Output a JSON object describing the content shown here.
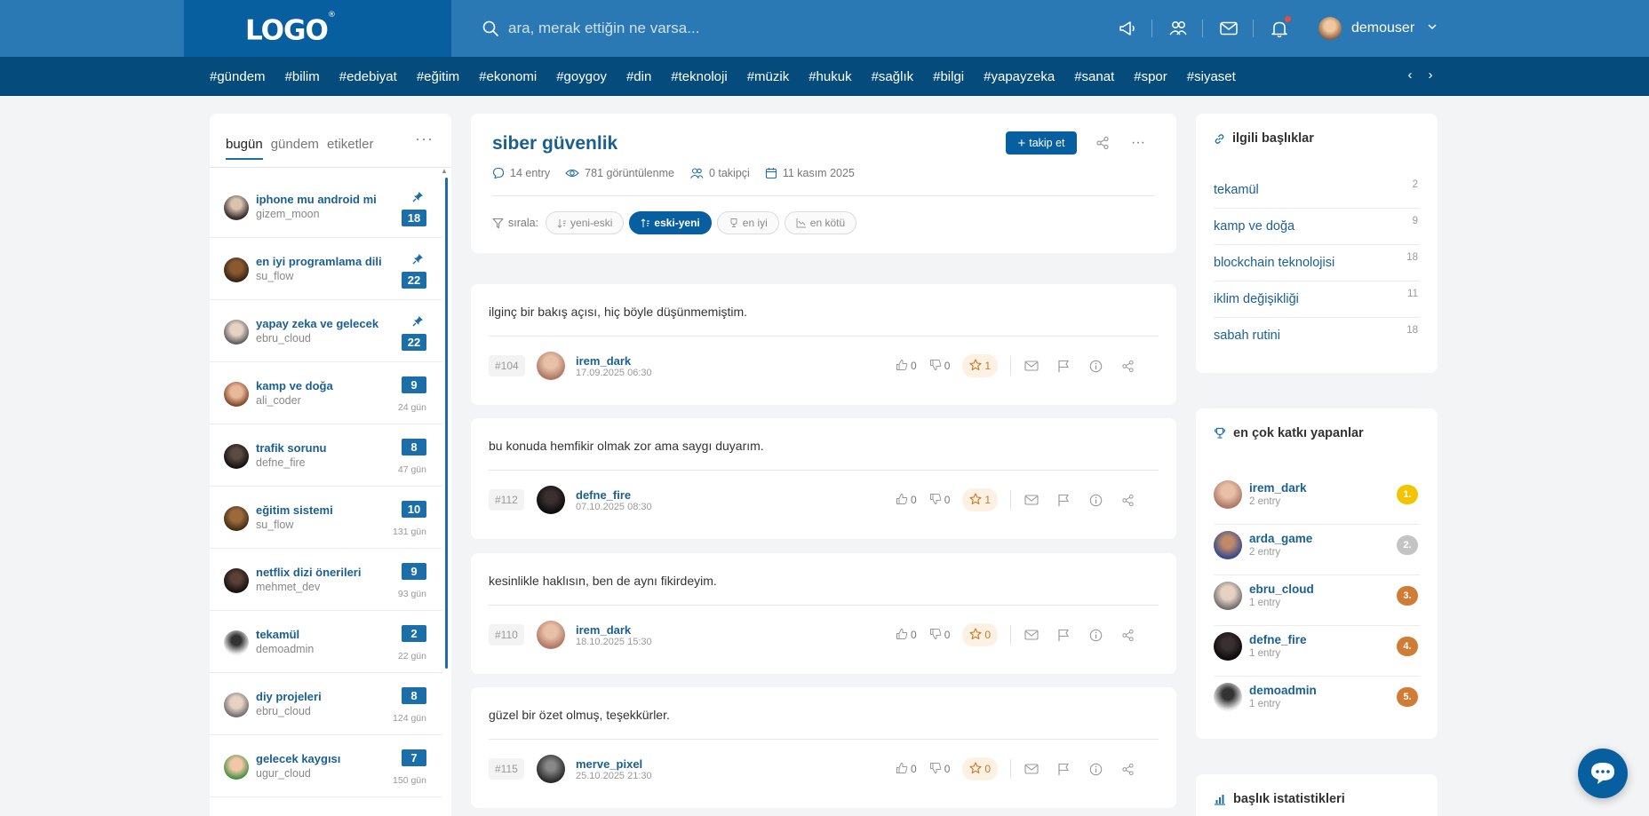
{
  "header": {
    "logo": "LOGO",
    "logo_mark": "®",
    "search_placeholder": "ara, merak ettiğin ne varsa...",
    "username": "demouser"
  },
  "tags": [
    "#gündem",
    "#bilim",
    "#edebiyat",
    "#eğitim",
    "#ekonomi",
    "#goygoy",
    "#din",
    "#teknoloji",
    "#müzik",
    "#hukuk",
    "#sağlık",
    "#bilgi",
    "#yapayzeka",
    "#sanat",
    "#spor",
    "#siyaset"
  ],
  "sidebar": {
    "tabs": [
      "bugün",
      "gündem",
      "etiketler"
    ],
    "more": "···",
    "topics": [
      {
        "title": "iphone mu android mi",
        "user": "gizem_moon",
        "count": "18",
        "pinned": true,
        "age": ""
      },
      {
        "title": "en iyi programlama dili",
        "user": "su_flow",
        "count": "22",
        "pinned": true,
        "age": ""
      },
      {
        "title": "yapay zeka ve gelecek",
        "user": "ebru_cloud",
        "count": "22",
        "pinned": true,
        "age": ""
      },
      {
        "title": "kamp ve doğa",
        "user": "ali_coder",
        "count": "9",
        "pinned": false,
        "age": "24 gün"
      },
      {
        "title": "trafik sorunu",
        "user": "defne_fire",
        "count": "8",
        "pinned": false,
        "age": "47 gün"
      },
      {
        "title": "eğitim sistemi",
        "user": "su_flow",
        "count": "10",
        "pinned": false,
        "age": "131 gün"
      },
      {
        "title": "netflix dizi önerileri",
        "user": "mehmet_dev",
        "count": "9",
        "pinned": false,
        "age": "93 gün"
      },
      {
        "title": "tekamül",
        "user": "demoadmin",
        "count": "2",
        "pinned": false,
        "age": "22 gün"
      },
      {
        "title": "diy projeleri",
        "user": "ebru_cloud",
        "count": "8",
        "pinned": false,
        "age": "124 gün"
      },
      {
        "title": "gelecek kaygısı",
        "user": "ugur_cloud",
        "count": "7",
        "pinned": false,
        "age": "150 gün"
      }
    ]
  },
  "topic": {
    "title": "siber güvenlik",
    "follow_label": "takip et",
    "entries_count": "14 entry",
    "views": "781 görüntülenme",
    "followers": "0 takipçi",
    "date": "11 kasım 2025",
    "sort_label": "sırala:",
    "sort_options": [
      "yeni-eski",
      "eski-yeni",
      "en iyi",
      "en kötü"
    ],
    "sort_active": 1
  },
  "entries": [
    {
      "text": "ilginç bir bakış açısı, hiç böyle düşünmemiştim.",
      "num": "#104",
      "user": "irem_dark",
      "date": "17.09.2025 06:30",
      "up": "0",
      "down": "0",
      "fav": "1"
    },
    {
      "text": "bu konuda hemfikir olmak zor ama saygı duyarım.",
      "num": "#112",
      "user": "defne_fire",
      "date": "07.10.2025 08:30",
      "up": "0",
      "down": "0",
      "fav": "1"
    },
    {
      "text": "kesinlikle haklısın, ben de aynı fikirdeyim.",
      "num": "#110",
      "user": "irem_dark",
      "date": "18.10.2025 15:30",
      "up": "0",
      "down": "0",
      "fav": "0"
    },
    {
      "text": "güzel bir özet olmuş, teşekkürler.",
      "num": "#115",
      "user": "merve_pixel",
      "date": "25.10.2025 21:30",
      "up": "0",
      "down": "0",
      "fav": "0"
    }
  ],
  "related": {
    "title": "ilgili başlıklar",
    "items": [
      {
        "name": "tekamül",
        "count": "2"
      },
      {
        "name": "kamp ve doğa",
        "count": "9"
      },
      {
        "name": "blockchain teknolojisi",
        "count": "18"
      },
      {
        "name": "iklim değişikliği",
        "count": "11"
      },
      {
        "name": "sabah rutini",
        "count": "18"
      }
    ]
  },
  "contributors": {
    "title": "en çok katkı yapanlar",
    "items": [
      {
        "name": "irem_dark",
        "sub": "2 entry",
        "rank": "1.",
        "color": "#f5c400"
      },
      {
        "name": "arda_game",
        "sub": "2 entry",
        "rank": "2.",
        "color": "#c4c4c4"
      },
      {
        "name": "ebru_cloud",
        "sub": "1 entry",
        "rank": "3.",
        "color": "#d07c35"
      },
      {
        "name": "defne_fire",
        "sub": "1 entry",
        "rank": "4.",
        "color": "#d07c35"
      },
      {
        "name": "demoadmin",
        "sub": "1 entry",
        "rank": "5.",
        "color": "#d07c35"
      }
    ]
  },
  "stats": {
    "title": "başlık istatistikleri"
  },
  "colors": {
    "primary": "#075f9f",
    "header": "#2a79b4",
    "tagbar": "#054c7c",
    "fav": "#c77a26"
  }
}
